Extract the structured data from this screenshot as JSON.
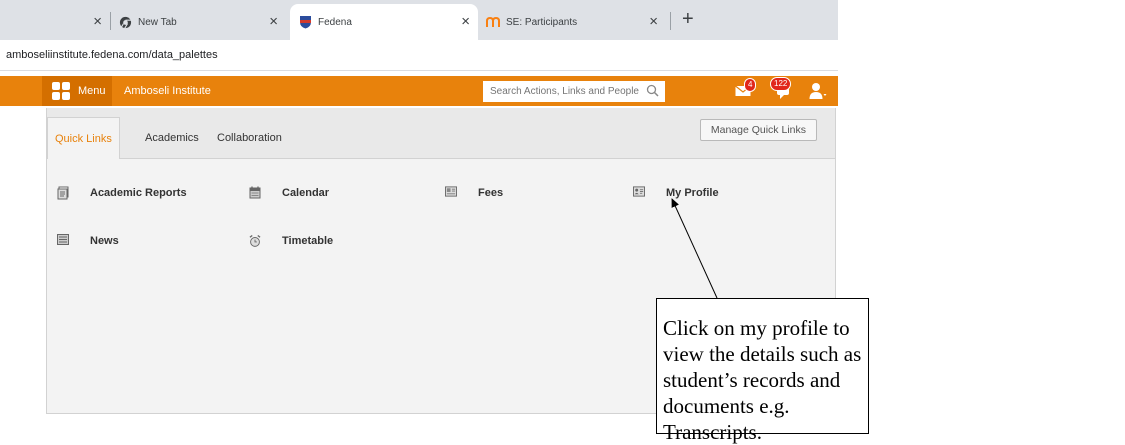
{
  "browser": {
    "tabs": [
      {
        "title": "",
        "close": "×"
      },
      {
        "title": "New Tab",
        "icon": "chrome-logo-icon",
        "close": "×"
      },
      {
        "title": "Fedena",
        "icon": "fedena-shield-icon",
        "active": true,
        "close": "×"
      },
      {
        "title": "SE: Participants",
        "icon": "moodle-m-icon",
        "close": "×"
      }
    ],
    "new_tab": "+",
    "url": "amboseliinstitute.fedena.com/data_palettes"
  },
  "header": {
    "menu_label": "Menu",
    "institution": "Amboseli Institute",
    "search_placeholder": "Search Actions, Links and People",
    "mail_count": "4",
    "notification_count": "122",
    "colors": {
      "bar": "#e8820c",
      "menu": "#d46f00",
      "badge": "#e1271b"
    }
  },
  "panel": {
    "tabs": [
      {
        "label": "Quick Links",
        "active": true
      },
      {
        "label": "Academics"
      },
      {
        "label": "Collaboration"
      }
    ],
    "manage_button": "Manage Quick Links",
    "links": [
      {
        "label": "Academic Reports",
        "icon": "report-icon"
      },
      {
        "label": "Calendar",
        "icon": "calendar-icon"
      },
      {
        "label": "Fees",
        "icon": "fees-icon"
      },
      {
        "label": "My Profile",
        "icon": "profile-card-icon"
      },
      {
        "label": "News",
        "icon": "news-icon"
      },
      {
        "label": "Timetable",
        "icon": "alarm-clock-icon"
      }
    ]
  },
  "annotation": {
    "text": "Click on my profile to view the details such as student’s records and documents e.g. Transcripts."
  }
}
